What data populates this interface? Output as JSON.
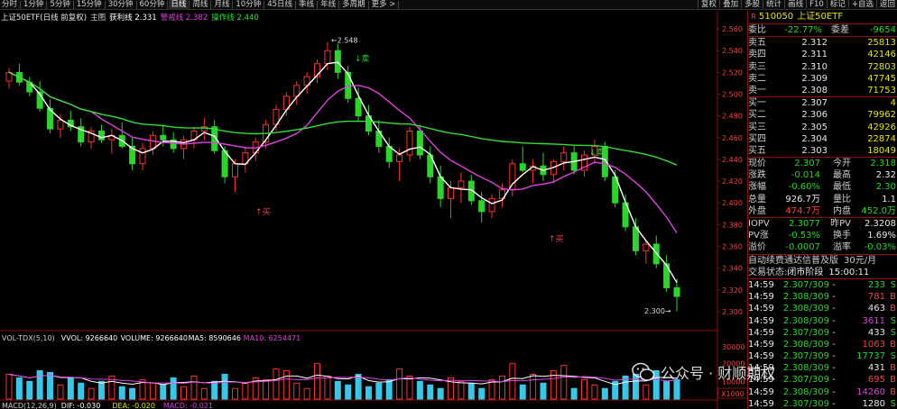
{
  "toolbar": {
    "left": [
      "分时",
      "1分钟",
      "5分钟",
      "15分钟",
      "30分钟",
      "60分钟",
      "日线",
      "周线",
      "月线",
      "10分钟",
      "45日线",
      "季线",
      "年线",
      "多周期",
      "更多 >"
    ],
    "active": "日线",
    "right": [
      "复权",
      "叠加",
      "多股",
      "统计",
      "画线",
      "F10",
      "标记",
      "+自选",
      "返回"
    ]
  },
  "legend": {
    "symbol": "上证50ETF(日线 前复权)",
    "main": "主图",
    "indicator": "获利线",
    "indicator_value": "2.331",
    "warn_label": "警戒线",
    "warn_value": "2.382",
    "op_label": "操作线",
    "op_value": "2.440"
  },
  "colors": {
    "up": "#ff3030",
    "down": "#2bd62b",
    "ma_white": "#ffffff",
    "ma_mag": "#e040e0",
    "ma_green": "#30e030",
    "bg": "#000000"
  },
  "price_axis": [
    "2.560",
    "2.540",
    "2.520",
    "2.500",
    "2.480",
    "2.460",
    "2.440",
    "2.420",
    "2.400",
    "2.380",
    "2.360",
    "2.340",
    "2.320",
    "2.300"
  ],
  "annotations": {
    "high": "2.548",
    "low": "2.300",
    "buy": "买",
    "sell": "卖"
  },
  "volume_legend": {
    "name": "VOL-TDX(5,10)",
    "vvol": "VVOL: 9266640",
    "volume": "VOLUME: 9266640",
    "ma5": "MA5: 8590646",
    "ma10": "MA10: 6254471"
  },
  "volume_axis": {
    "top": "30000",
    "mid": "20000",
    "low": "10000",
    "unit": "X1000"
  },
  "macd_legend": {
    "name": "MACD(12,26,9)",
    "dif": "DIF: -0.030",
    "dea": "DEA: -0.020",
    "macd": "MACD: -0.021"
  },
  "chart_data": {
    "type": "candlestick",
    "ylim": [
      2.29,
      2.565
    ],
    "candles": [
      [
        2.512,
        2.524,
        2.505,
        2.52
      ],
      [
        2.52,
        2.528,
        2.508,
        2.511
      ],
      [
        2.511,
        2.516,
        2.498,
        2.502
      ],
      [
        2.502,
        2.512,
        2.484,
        2.487
      ],
      [
        2.487,
        2.495,
        2.464,
        2.468
      ],
      [
        2.468,
        2.482,
        2.46,
        2.476
      ],
      [
        2.476,
        2.485,
        2.466,
        2.47
      ],
      [
        2.47,
        2.478,
        2.452,
        2.456
      ],
      [
        2.456,
        2.47,
        2.45,
        2.466
      ],
      [
        2.466,
        2.472,
        2.455,
        2.458
      ],
      [
        2.458,
        2.468,
        2.445,
        2.462
      ],
      [
        2.462,
        2.474,
        2.45,
        2.452
      ],
      [
        2.452,
        2.46,
        2.43,
        2.436
      ],
      [
        2.436,
        2.455,
        2.43,
        2.45
      ],
      [
        2.45,
        2.466,
        2.444,
        2.462
      ],
      [
        2.462,
        2.472,
        2.452,
        2.458
      ],
      [
        2.458,
        2.465,
        2.446,
        2.45
      ],
      [
        2.45,
        2.462,
        2.44,
        2.458
      ],
      [
        2.458,
        2.47,
        2.45,
        2.466
      ],
      [
        2.466,
        2.478,
        2.458,
        2.47
      ],
      [
        2.47,
        2.476,
        2.445,
        2.448
      ],
      [
        2.448,
        2.452,
        2.418,
        2.424
      ],
      [
        2.424,
        2.44,
        2.41,
        2.436
      ],
      [
        2.436,
        2.452,
        2.428,
        2.446
      ],
      [
        2.446,
        2.46,
        2.438,
        2.456
      ],
      [
        2.456,
        2.476,
        2.45,
        2.472
      ],
      [
        2.472,
        2.49,
        2.466,
        2.486
      ],
      [
        2.486,
        2.502,
        2.48,
        2.498
      ],
      [
        2.498,
        2.512,
        2.49,
        2.508
      ],
      [
        2.508,
        2.52,
        2.5,
        2.516
      ],
      [
        2.516,
        2.532,
        2.51,
        2.528
      ],
      [
        2.528,
        2.548,
        2.522,
        2.54
      ],
      [
        2.54,
        2.546,
        2.514,
        2.52
      ],
      [
        2.52,
        2.526,
        2.492,
        2.496
      ],
      [
        2.496,
        2.506,
        2.476,
        2.48
      ],
      [
        2.48,
        2.49,
        2.462,
        2.466
      ],
      [
        2.466,
        2.476,
        2.446,
        2.452
      ],
      [
        2.452,
        2.46,
        2.432,
        2.438
      ],
      [
        2.438,
        2.45,
        2.42,
        2.444
      ],
      [
        2.444,
        2.47,
        2.438,
        2.466
      ],
      [
        2.466,
        2.472,
        2.44,
        2.444
      ],
      [
        2.444,
        2.452,
        2.418,
        2.424
      ],
      [
        2.424,
        2.434,
        2.396,
        2.404
      ],
      [
        2.404,
        2.42,
        2.386,
        2.414
      ],
      [
        2.414,
        2.428,
        2.4,
        2.42
      ],
      [
        2.42,
        2.426,
        2.398,
        2.402
      ],
      [
        2.402,
        2.41,
        2.382,
        2.392
      ],
      [
        2.392,
        2.408,
        2.386,
        2.404
      ],
      [
        2.404,
        2.418,
        2.396,
        2.412
      ],
      [
        2.412,
        2.44,
        2.406,
        2.436
      ],
      [
        2.436,
        2.452,
        2.428,
        2.43
      ],
      [
        2.43,
        2.44,
        2.418,
        2.434
      ],
      [
        2.434,
        2.446,
        2.42,
        2.426
      ],
      [
        2.426,
        2.44,
        2.418,
        2.438
      ],
      [
        2.438,
        2.452,
        2.43,
        2.446
      ],
      [
        2.446,
        2.452,
        2.426,
        2.43
      ],
      [
        2.43,
        2.448,
        2.424,
        2.444
      ],
      [
        2.444,
        2.458,
        2.436,
        2.452
      ],
      [
        2.452,
        2.456,
        2.42,
        2.424
      ],
      [
        2.424,
        2.43,
        2.396,
        2.4
      ],
      [
        2.4,
        2.408,
        2.374,
        2.378
      ],
      [
        2.378,
        2.386,
        2.352,
        2.356
      ],
      [
        2.356,
        2.366,
        2.344,
        2.362
      ],
      [
        2.362,
        2.37,
        2.34,
        2.344
      ],
      [
        2.344,
        2.352,
        2.318,
        2.322
      ],
      [
        2.322,
        2.33,
        2.3,
        2.314
      ]
    ],
    "volume": [
      14,
      12,
      10,
      16,
      15,
      8,
      12,
      9,
      6,
      10,
      13,
      7,
      6,
      11,
      9,
      8,
      12,
      7,
      13,
      6,
      10,
      14,
      6,
      9,
      12,
      11,
      17,
      16,
      9,
      6,
      20,
      13,
      10,
      8,
      14,
      7,
      9,
      11,
      17,
      13,
      10,
      8,
      6,
      12,
      10,
      9,
      6,
      11,
      13,
      20,
      8,
      14,
      9,
      16,
      19,
      6,
      11,
      8,
      6,
      10,
      13,
      14,
      8,
      16,
      10,
      11
    ]
  },
  "panel": {
    "header": {
      "code": "510050",
      "name": "上证50ETF",
      "mark": "R"
    },
    "ratio": {
      "label": "委比",
      "value": "-22.77%",
      "label2": "委差",
      "value2": "-9654"
    },
    "sells": [
      {
        "label": "卖五",
        "price": "2.312",
        "vol": "25813"
      },
      {
        "label": "卖四",
        "price": "2.311",
        "vol": "42146"
      },
      {
        "label": "卖三",
        "price": "2.310",
        "vol": "72803"
      },
      {
        "label": "卖二",
        "price": "2.309",
        "vol": "47745"
      },
      {
        "label": "卖一",
        "price": "2.308",
        "vol": "71753"
      }
    ],
    "buys": [
      {
        "label": "买一",
        "price": "2.307",
        "vol": "4"
      },
      {
        "label": "买二",
        "price": "2.306",
        "vol": "79962"
      },
      {
        "label": "买三",
        "price": "2.305",
        "vol": "42926"
      },
      {
        "label": "买四",
        "price": "2.304",
        "vol": "22874"
      },
      {
        "label": "买五",
        "price": "2.303",
        "vol": "18049"
      }
    ],
    "stats": [
      {
        "l1": "现价",
        "v1": "2.307",
        "c1": "green",
        "l2": "今开",
        "v2": "2.318",
        "c2": "green"
      },
      {
        "l1": "涨跌",
        "v1": "-0.014",
        "c1": "green",
        "l2": "最高",
        "v2": "2.32",
        "c2": "white"
      },
      {
        "l1": "涨幅",
        "v1": "-0.60%",
        "c1": "green",
        "l2": "最低",
        "v2": "2.30",
        "c2": "green"
      },
      {
        "l1": "总量",
        "v1": "926.7万",
        "c1": "white",
        "l2": "量比",
        "v2": "1.1",
        "c2": "white"
      },
      {
        "l1": "外盘",
        "v1": "474.7万",
        "c1": "red",
        "l2": "内盘",
        "v2": "452.0万",
        "c2": "green"
      }
    ],
    "iopv": [
      {
        "l1": "IOPV",
        "v1": "2.3077",
        "c1": "green",
        "l2": "昨PV",
        "v2": "2.3208",
        "c2": "white"
      },
      {
        "l1": "PV涨",
        "v1": "-0.53%",
        "c1": "green",
        "l2": "换手",
        "v2": "1.69%",
        "c2": "white"
      },
      {
        "l1": "溢价",
        "v1": "-0.0007",
        "c1": "green",
        "l2": "溢率",
        "v2": "-0.03%",
        "c2": "green"
      }
    ],
    "promo": {
      "text": "自动续费通达信普及版",
      "price": "30元/月"
    },
    "status": {
      "label": "交易状态:",
      "value": "闭市阶段",
      "time": "15:00:11"
    },
    "ticks": [
      {
        "t": "14:59",
        "p": "2.307/309",
        "d": "-",
        "v": "233",
        "s": "S",
        "c": "green"
      },
      {
        "t": "14:59",
        "p": "2.308/309",
        "d": "-",
        "v": "781",
        "s": "B",
        "c": "red"
      },
      {
        "t": "14:59",
        "p": "2.308/309",
        "d": "-",
        "v": "463",
        "s": "B",
        "c": "white"
      },
      {
        "t": "14:59",
        "p": "2.308/309",
        "d": "-",
        "v": "3611",
        "s": "S",
        "c": "mag"
      },
      {
        "t": "14:59",
        "p": "2.307/309",
        "d": "-",
        "v": "433",
        "s": "S",
        "c": "white"
      },
      {
        "t": "14:59",
        "p": "2.308/309",
        "d": "-",
        "v": "1063",
        "s": "B",
        "c": "red"
      },
      {
        "t": "14:59",
        "p": "2.307/309",
        "d": "-",
        "v": "17737",
        "s": "S",
        "c": "green"
      },
      {
        "t": "14:59",
        "p": "2.308/309",
        "d": "-",
        "v": "431",
        "s": "B",
        "c": "white"
      },
      {
        "t": "14:59",
        "p": "2.307/309",
        "d": "-",
        "v": "695",
        "s": "B",
        "c": "red"
      },
      {
        "t": "14:59",
        "p": "2.308/309",
        "d": "-",
        "v": "14260",
        "s": "B",
        "c": "mag"
      },
      {
        "t": "14:59",
        "p": "2.307/309",
        "d": "-",
        "v": "1280",
        "s": "S",
        "c": "white"
      }
    ]
  },
  "watermark": {
    "text": "公众号 · 财顺期权"
  }
}
